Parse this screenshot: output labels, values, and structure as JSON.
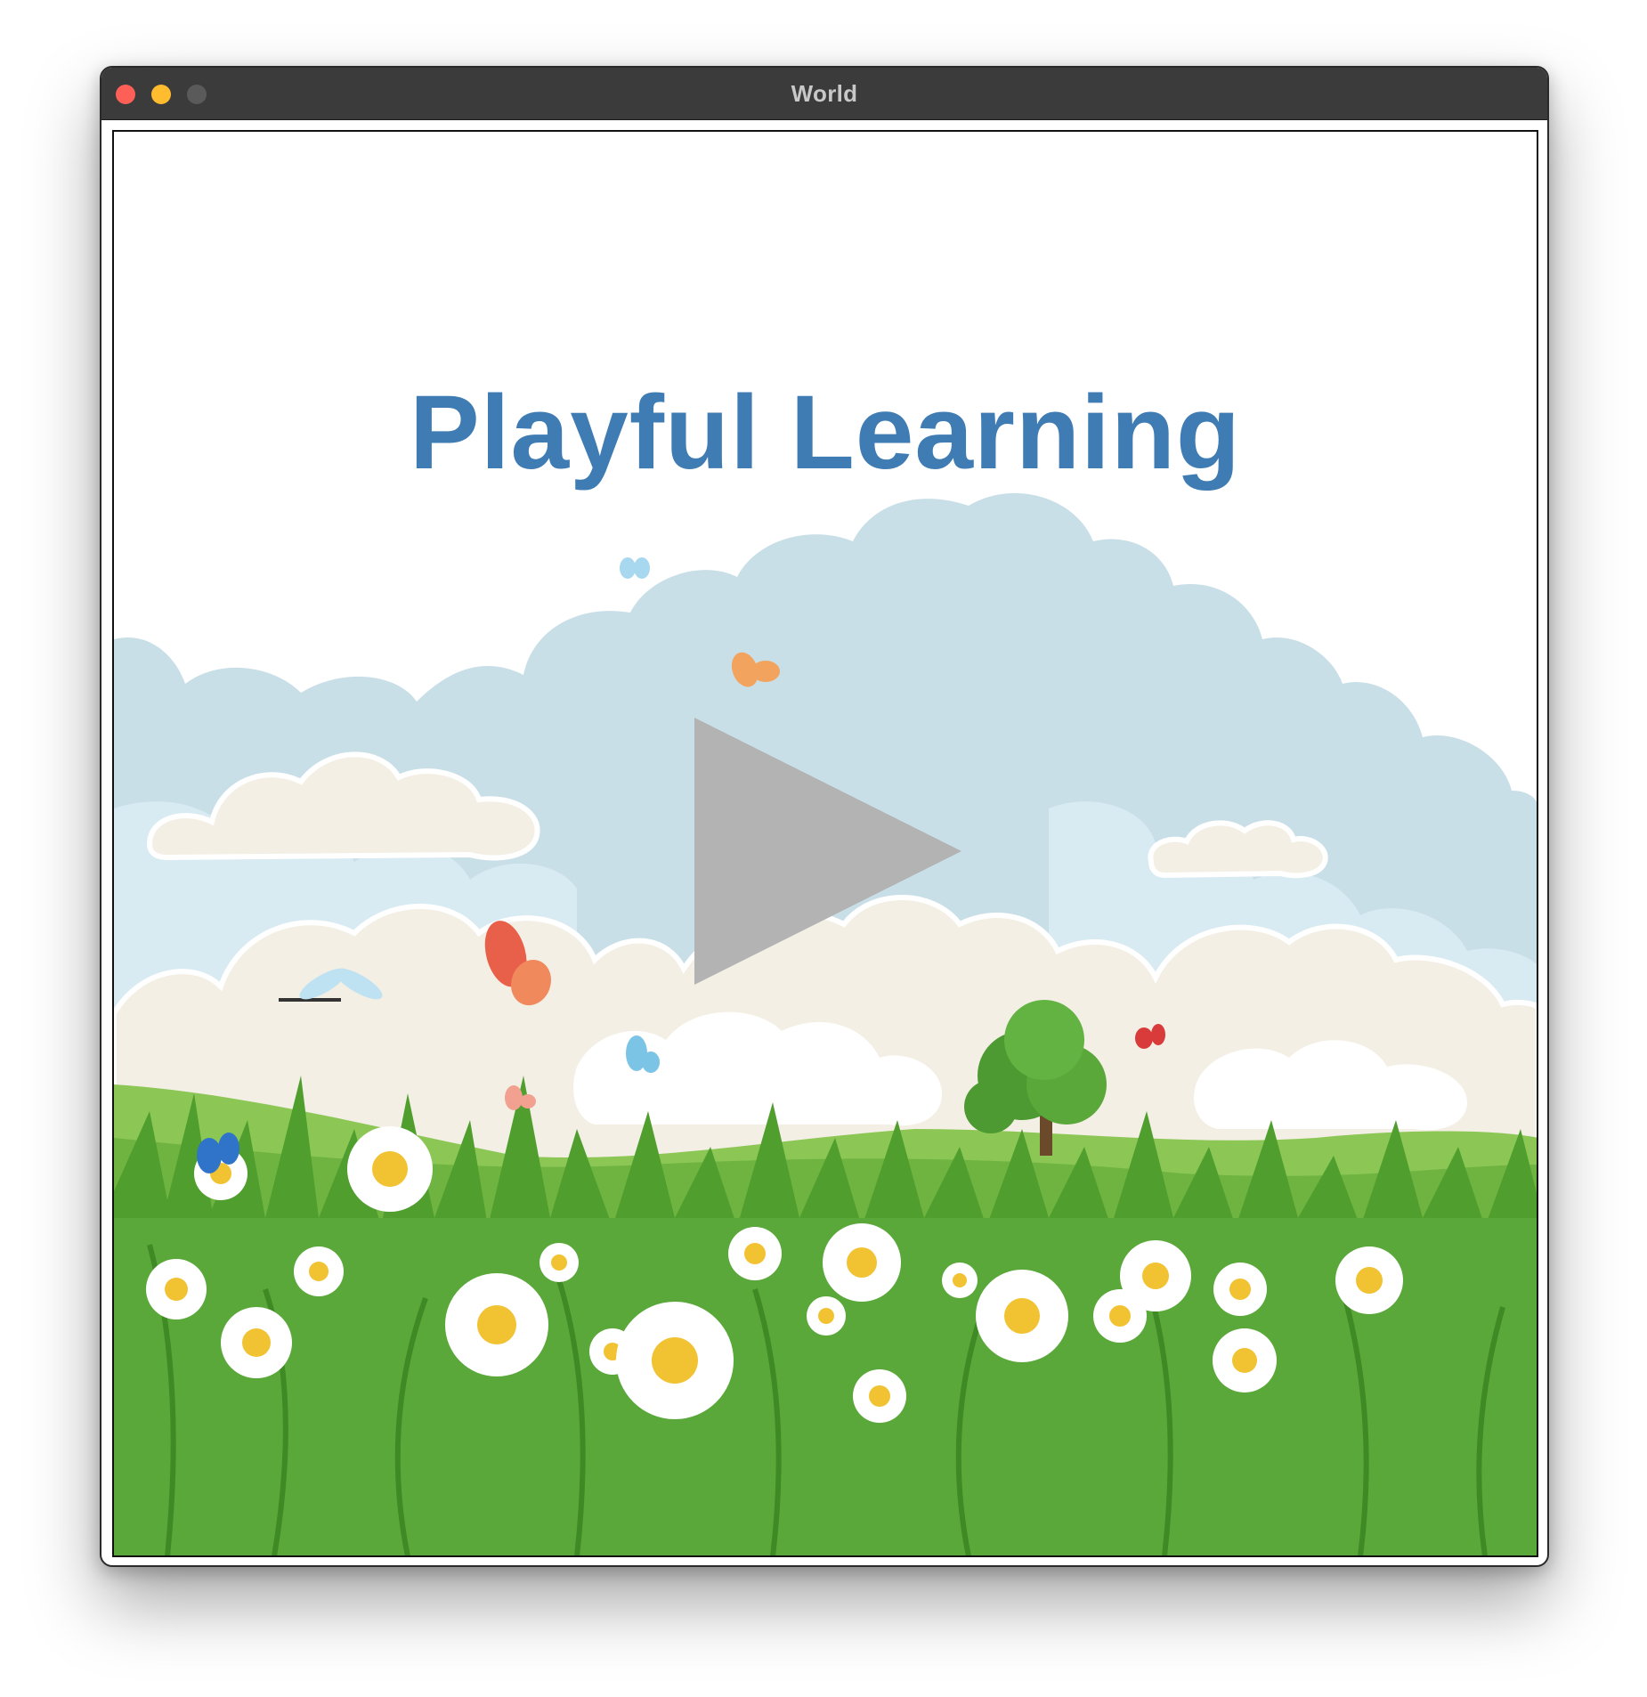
{
  "window": {
    "title": "World",
    "controls": {
      "close": "close",
      "minimize": "minimize",
      "zoom": "zoom"
    }
  },
  "main": {
    "headline": "Playful Learning",
    "headline_color": "#3f7cb4",
    "play_button": {
      "icon": "play-icon",
      "color": "#b3b3b3"
    }
  },
  "scene": {
    "sky_color": "#c9dfe8",
    "cloud_color": "#f3efe4",
    "grass_color": "#5aa83a",
    "flower_color": "#ffffff",
    "flower_center": "#f1c232"
  }
}
